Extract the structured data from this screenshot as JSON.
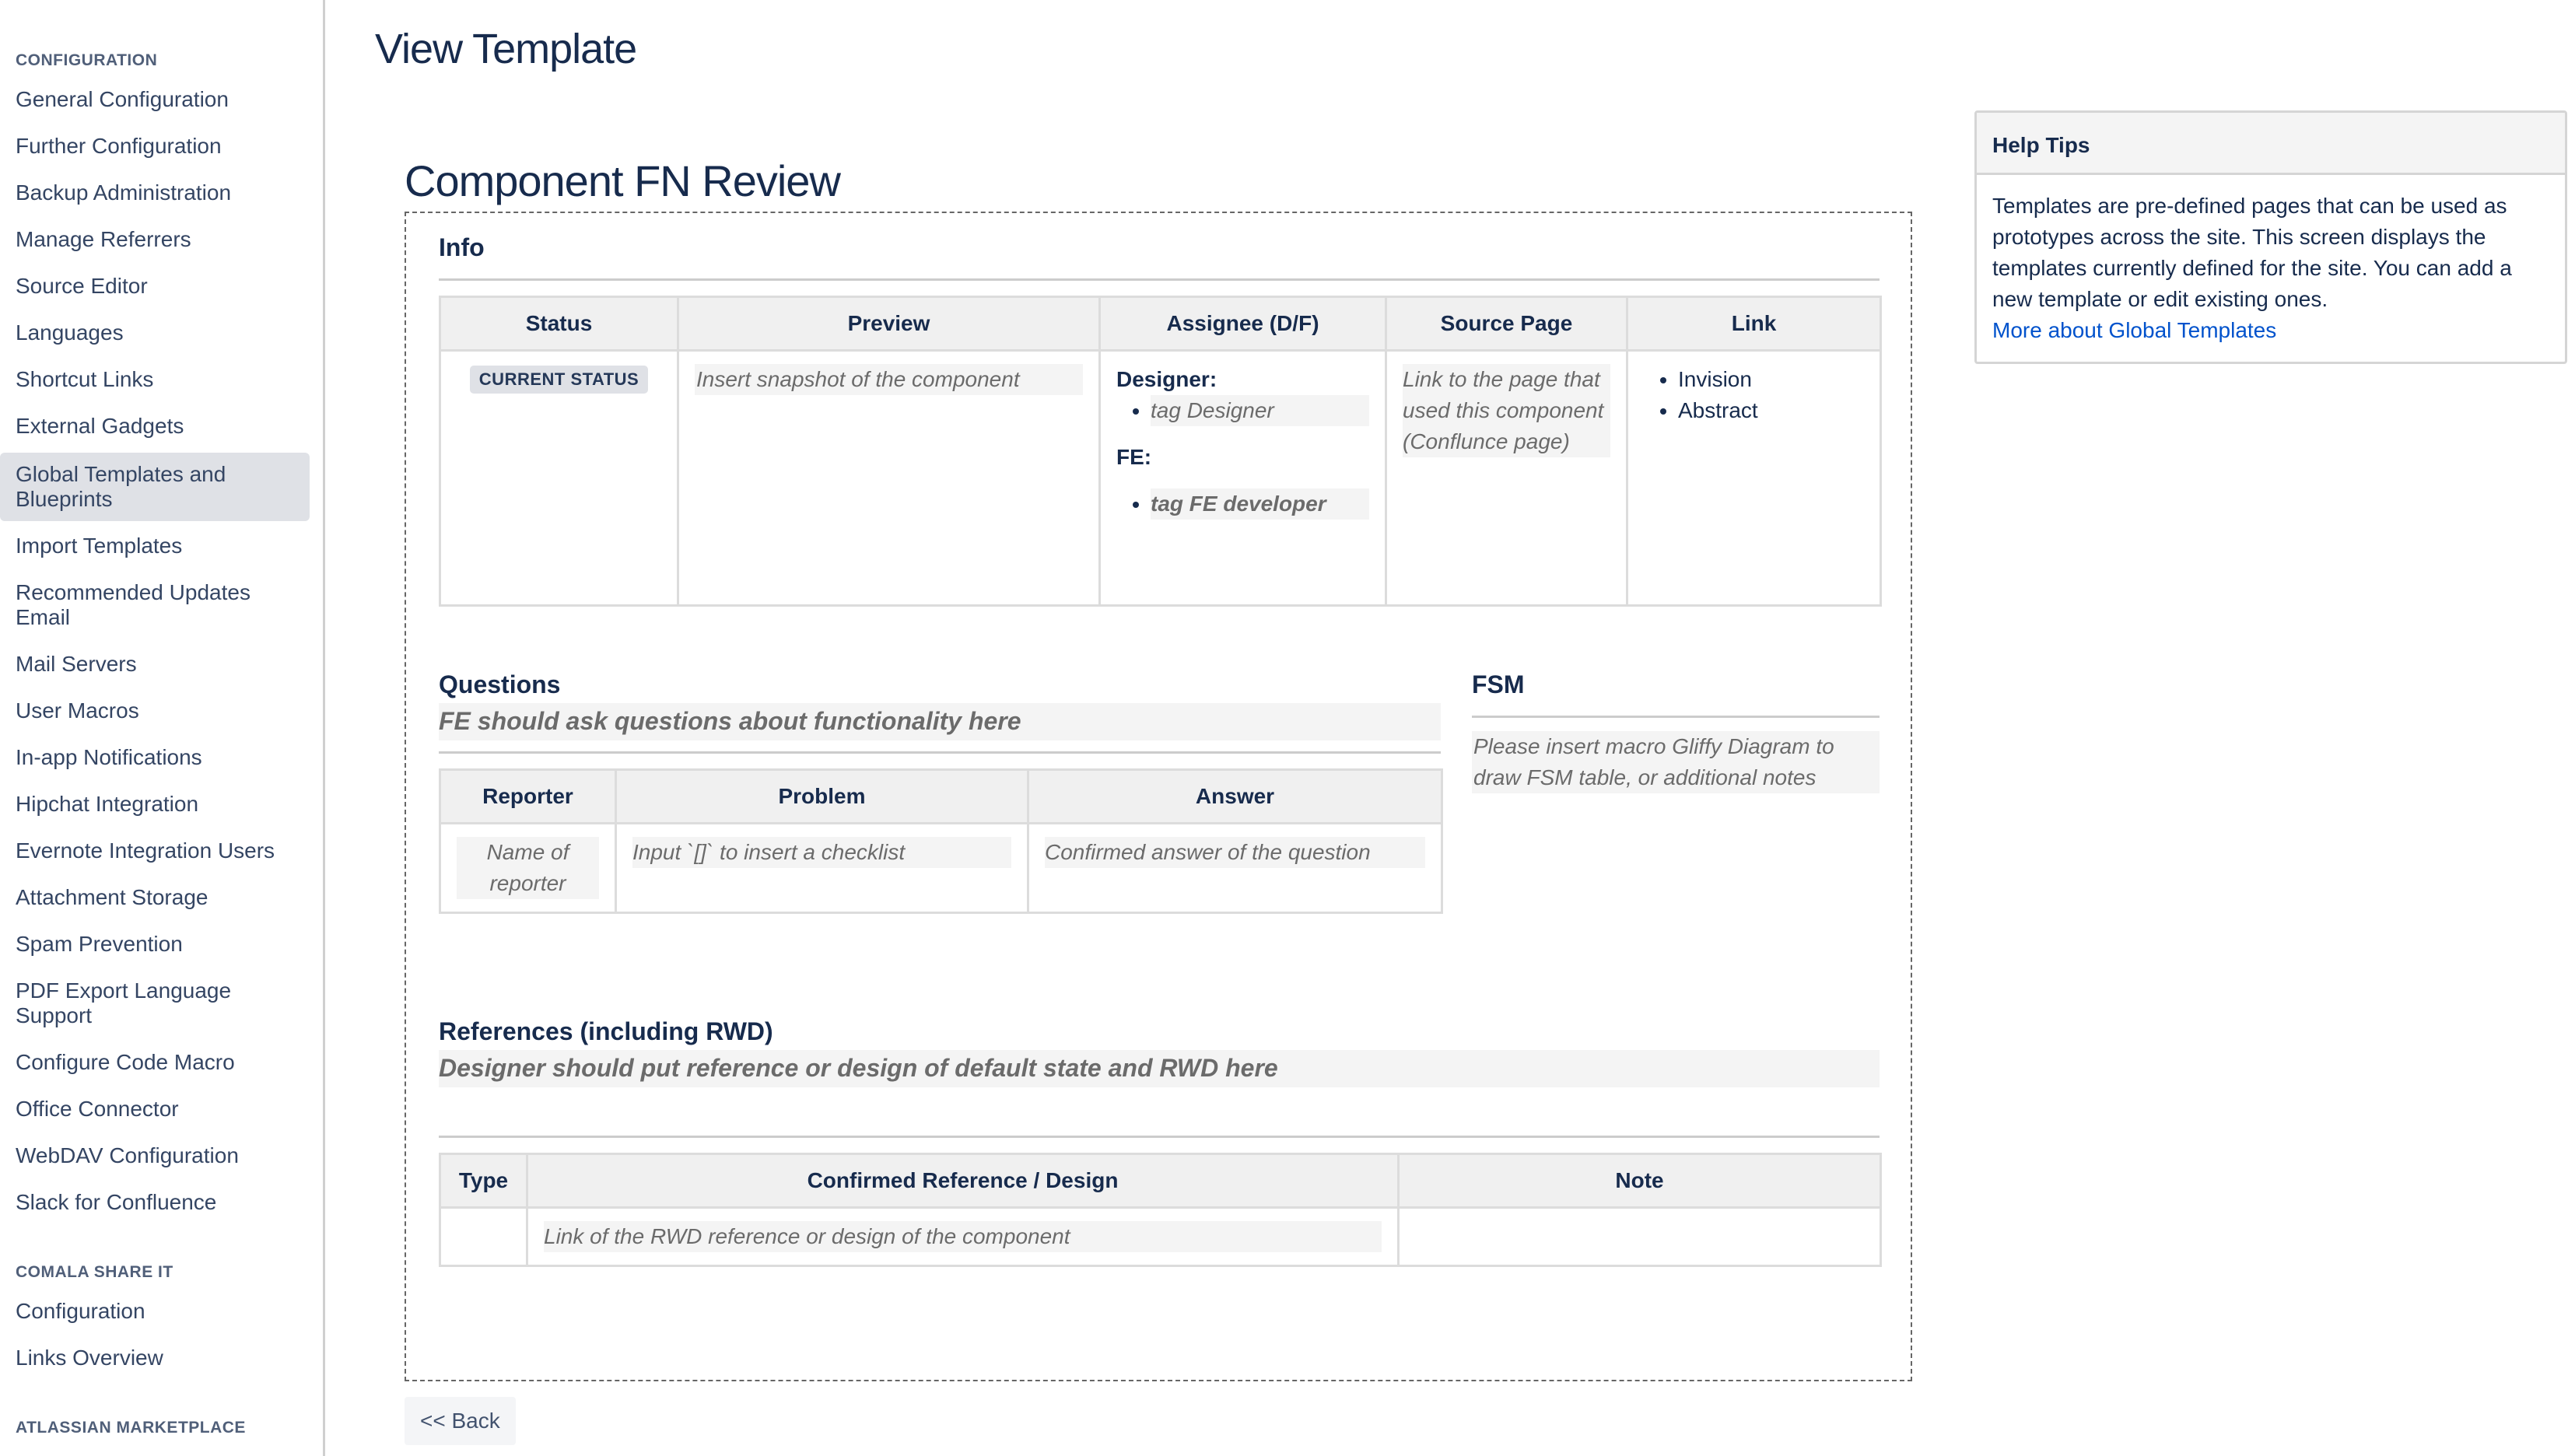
{
  "sidebar": {
    "sections": [
      {
        "heading": "CONFIGURATION",
        "items": [
          {
            "label": "General Configuration"
          },
          {
            "label": "Further Configuration"
          },
          {
            "label": "Backup Administration"
          },
          {
            "label": "Manage Referrers"
          },
          {
            "label": "Source Editor"
          },
          {
            "label": "Languages"
          },
          {
            "label": "Shortcut Links"
          },
          {
            "label": "External Gadgets"
          },
          {
            "label": "Global Templates and Blueprints",
            "active": true
          },
          {
            "label": "Import Templates"
          },
          {
            "label": "Recommended Updates Email"
          },
          {
            "label": "Mail Servers"
          },
          {
            "label": "User Macros"
          },
          {
            "label": "In-app Notifications"
          },
          {
            "label": "Hipchat Integration"
          },
          {
            "label": "Evernote Integration Users"
          },
          {
            "label": "Attachment Storage"
          },
          {
            "label": "Spam Prevention"
          },
          {
            "label": "PDF Export Language Support"
          },
          {
            "label": "Configure Code Macro"
          },
          {
            "label": "Office Connector"
          },
          {
            "label": "WebDAV Configuration"
          },
          {
            "label": "Slack for Confluence"
          }
        ]
      },
      {
        "heading": "COMALA SHARE IT",
        "items": [
          {
            "label": "Configuration"
          },
          {
            "label": "Links Overview"
          }
        ]
      },
      {
        "heading": "ATLASSIAN MARKETPLACE",
        "items": []
      }
    ]
  },
  "page": {
    "title": "View Template",
    "template_title": "Component FN Review",
    "back_label": "<< Back"
  },
  "info": {
    "title": "Info",
    "headers": [
      "Status",
      "Preview",
      "Assignee (D/F)",
      "Source Page",
      "Link"
    ],
    "status_lozenge": "CURRENT STATUS",
    "preview_placeholder": "Insert snapshot of the component",
    "designer_label": "Designer:",
    "designer_placeholder": "tag Designer",
    "fe_label": "FE:",
    "fe_placeholder": "tag FE developer",
    "source_page_placeholder": "Link to the page that used this component (Conflunce page)",
    "links": [
      "Invision",
      "Abstract"
    ]
  },
  "questions": {
    "title": "Questions",
    "instruction": "FE should ask questions about functionality here",
    "headers": [
      "Reporter",
      "Problem",
      "Answer"
    ],
    "row": {
      "reporter": "Name of reporter",
      "problem": "Input `[]` to insert a checklist",
      "answer": "Confirmed answer of the question"
    }
  },
  "fsm": {
    "title": "FSM",
    "placeholder": "Please insert macro Gliffy Diagram to draw FSM table, or additional notes"
  },
  "references": {
    "title": "References (including RWD)",
    "instruction": "Designer should put reference or design of default state and RWD here",
    "headers": [
      "Type",
      "Confirmed Reference / Design",
      "Note"
    ],
    "row": {
      "type": "",
      "reference": "Link of the RWD reference or design of the component",
      "note": ""
    }
  },
  "help": {
    "title": "Help Tips",
    "body": "Templates are pre-defined pages that can be used as prototypes across the site. This screen displays the templates currently defined for the site. You can add a new template or edit existing ones.",
    "link_label": "More about Global Templates"
  }
}
